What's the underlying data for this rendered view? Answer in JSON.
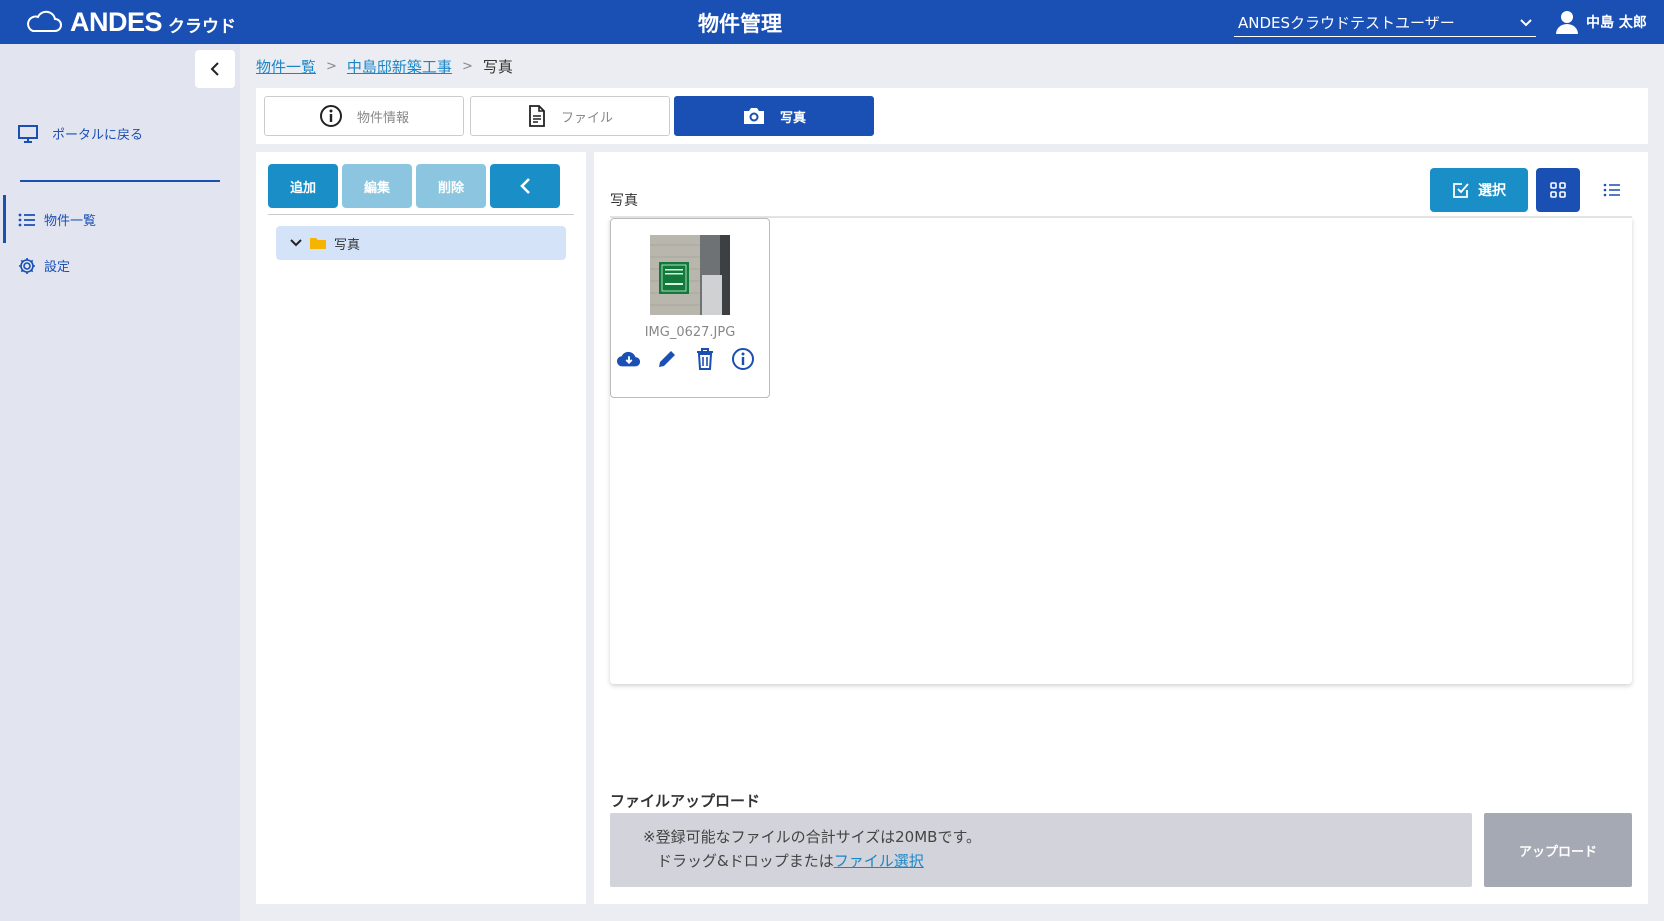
{
  "header": {
    "brand": "ANDES",
    "brand_sub": "クラウド",
    "title": "物件管理",
    "account_select": "ANDESクラウドテストユーザー",
    "user_name": "中島 太郎"
  },
  "sidebar": {
    "portal": "ポータルに戻る",
    "items": [
      {
        "label": "物件一覧",
        "icon": "list-icon",
        "active": true
      },
      {
        "label": "設定",
        "icon": "gear-icon",
        "active": false
      }
    ]
  },
  "breadcrumb": {
    "items": [
      "物件一覧",
      "中島邸新築工事"
    ],
    "current": "写真"
  },
  "tabs": [
    {
      "label": "物件情報",
      "icon": "info-icon"
    },
    {
      "label": "ファイル",
      "icon": "file-icon"
    },
    {
      "label": "写真",
      "icon": "camera-icon",
      "active": true
    }
  ],
  "left_toolbar": {
    "add": "追加",
    "edit": "編集",
    "delete": "削除"
  },
  "tree": {
    "folder": "写真"
  },
  "right": {
    "title": "写真",
    "select_label": "選択"
  },
  "photos": [
    {
      "name": "IMG_0627.JPG"
    }
  ],
  "upload": {
    "label": "ファイルアップロード",
    "note": "※登録可能なファイルの合計サイズは20MBです。",
    "drop_text": "ドラッグ&ドロップまたは",
    "select_link": "ファイル選択",
    "button": "アップロード"
  },
  "colors": {
    "header": "#1a4fb4",
    "accent": "#1a8fc7",
    "link": "#1a86c8"
  }
}
